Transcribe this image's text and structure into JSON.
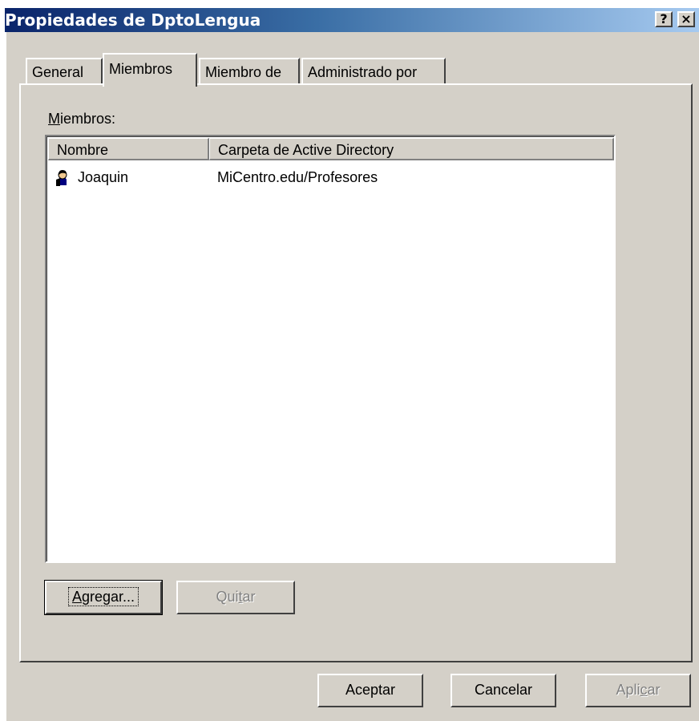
{
  "window": {
    "title": "Propiedades de DptoLengua",
    "help_label": "?",
    "close_label": "×"
  },
  "tabs": [
    {
      "label": "General",
      "active": false
    },
    {
      "label": "Miembros",
      "active": true
    },
    {
      "label": "Miembro de",
      "active": false
    },
    {
      "label": "Administrado por",
      "active": false
    }
  ],
  "members": {
    "label_mnemonic": "M",
    "label_rest": "iembros:",
    "columns": [
      "Nombre",
      "Carpeta de Active Directory"
    ],
    "rows": [
      {
        "icon": "user-icon",
        "name": "Joaquin",
        "folder": "MiCentro.edu/Profesores"
      }
    ]
  },
  "actions": {
    "add_mnemonic": "A",
    "add_rest": "gregar...",
    "remove_pre": "Qui",
    "remove_mnemonic": "t",
    "remove_post": "ar"
  },
  "footer": {
    "ok": "Aceptar",
    "cancel": "Cancelar",
    "apply_pre": "Apli",
    "apply_mnemonic": "c",
    "apply_post": "ar"
  }
}
